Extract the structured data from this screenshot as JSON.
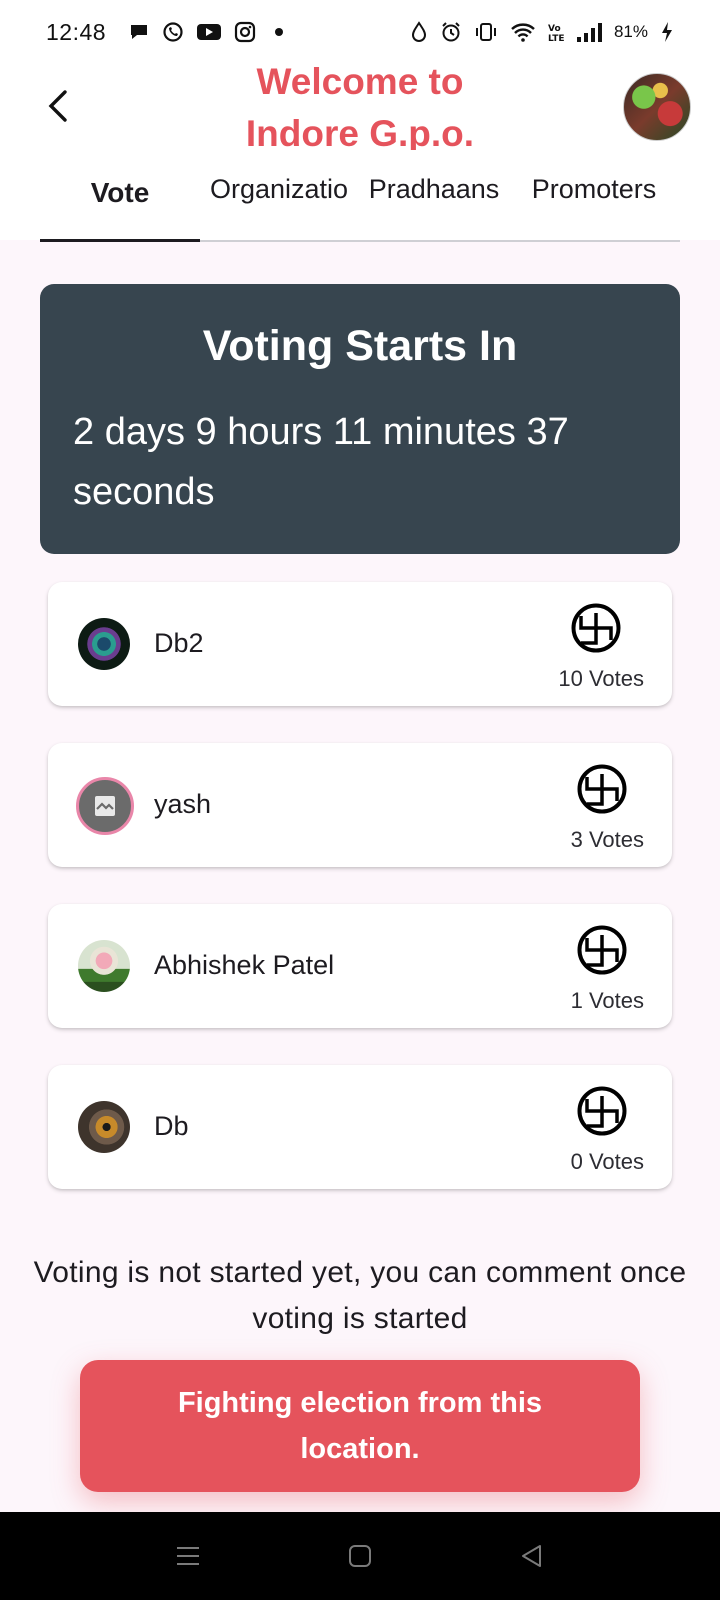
{
  "status_bar": {
    "time": "12:48",
    "battery": "81%",
    "icons_left": [
      "chat-bubble-icon",
      "whatsapp-icon",
      "youtube-icon",
      "instagram-icon",
      "dot-icon"
    ],
    "icons_right": [
      "water-drop-icon",
      "alarm-icon",
      "vibrate-icon",
      "wifi-icon",
      "volte-icon",
      "signal-icon",
      "battery-charging-icon"
    ]
  },
  "header": {
    "title_line1": "Welcome to",
    "title_line2": "Indore G.p.o.",
    "title_color": "#e5535c"
  },
  "tabs": [
    {
      "label": "Vote",
      "active": true
    },
    {
      "label": "Organizations",
      "active": false
    },
    {
      "label": "Pradhaans",
      "active": false
    },
    {
      "label": "Promoters",
      "active": false
    }
  ],
  "countdown": {
    "title": "Voting Starts In",
    "value": "2 days 9 hours 11 minutes 37 seconds"
  },
  "candidates": [
    {
      "name": "Db2",
      "votes": "10 Votes"
    },
    {
      "name": "yash",
      "votes": "3 Votes"
    },
    {
      "name": "Abhishek Patel",
      "votes": "1 Votes"
    },
    {
      "name": "Db",
      "votes": "0 Votes"
    }
  ],
  "info_text": "Voting is not started yet, you can comment once voting is started",
  "fight_button": {
    "label": "Fighting election from this location.",
    "color": "#e5535c"
  },
  "colors": {
    "accent": "#e5535c",
    "countdown_bg": "#37454f",
    "page_bg": "#fdf6fb"
  }
}
